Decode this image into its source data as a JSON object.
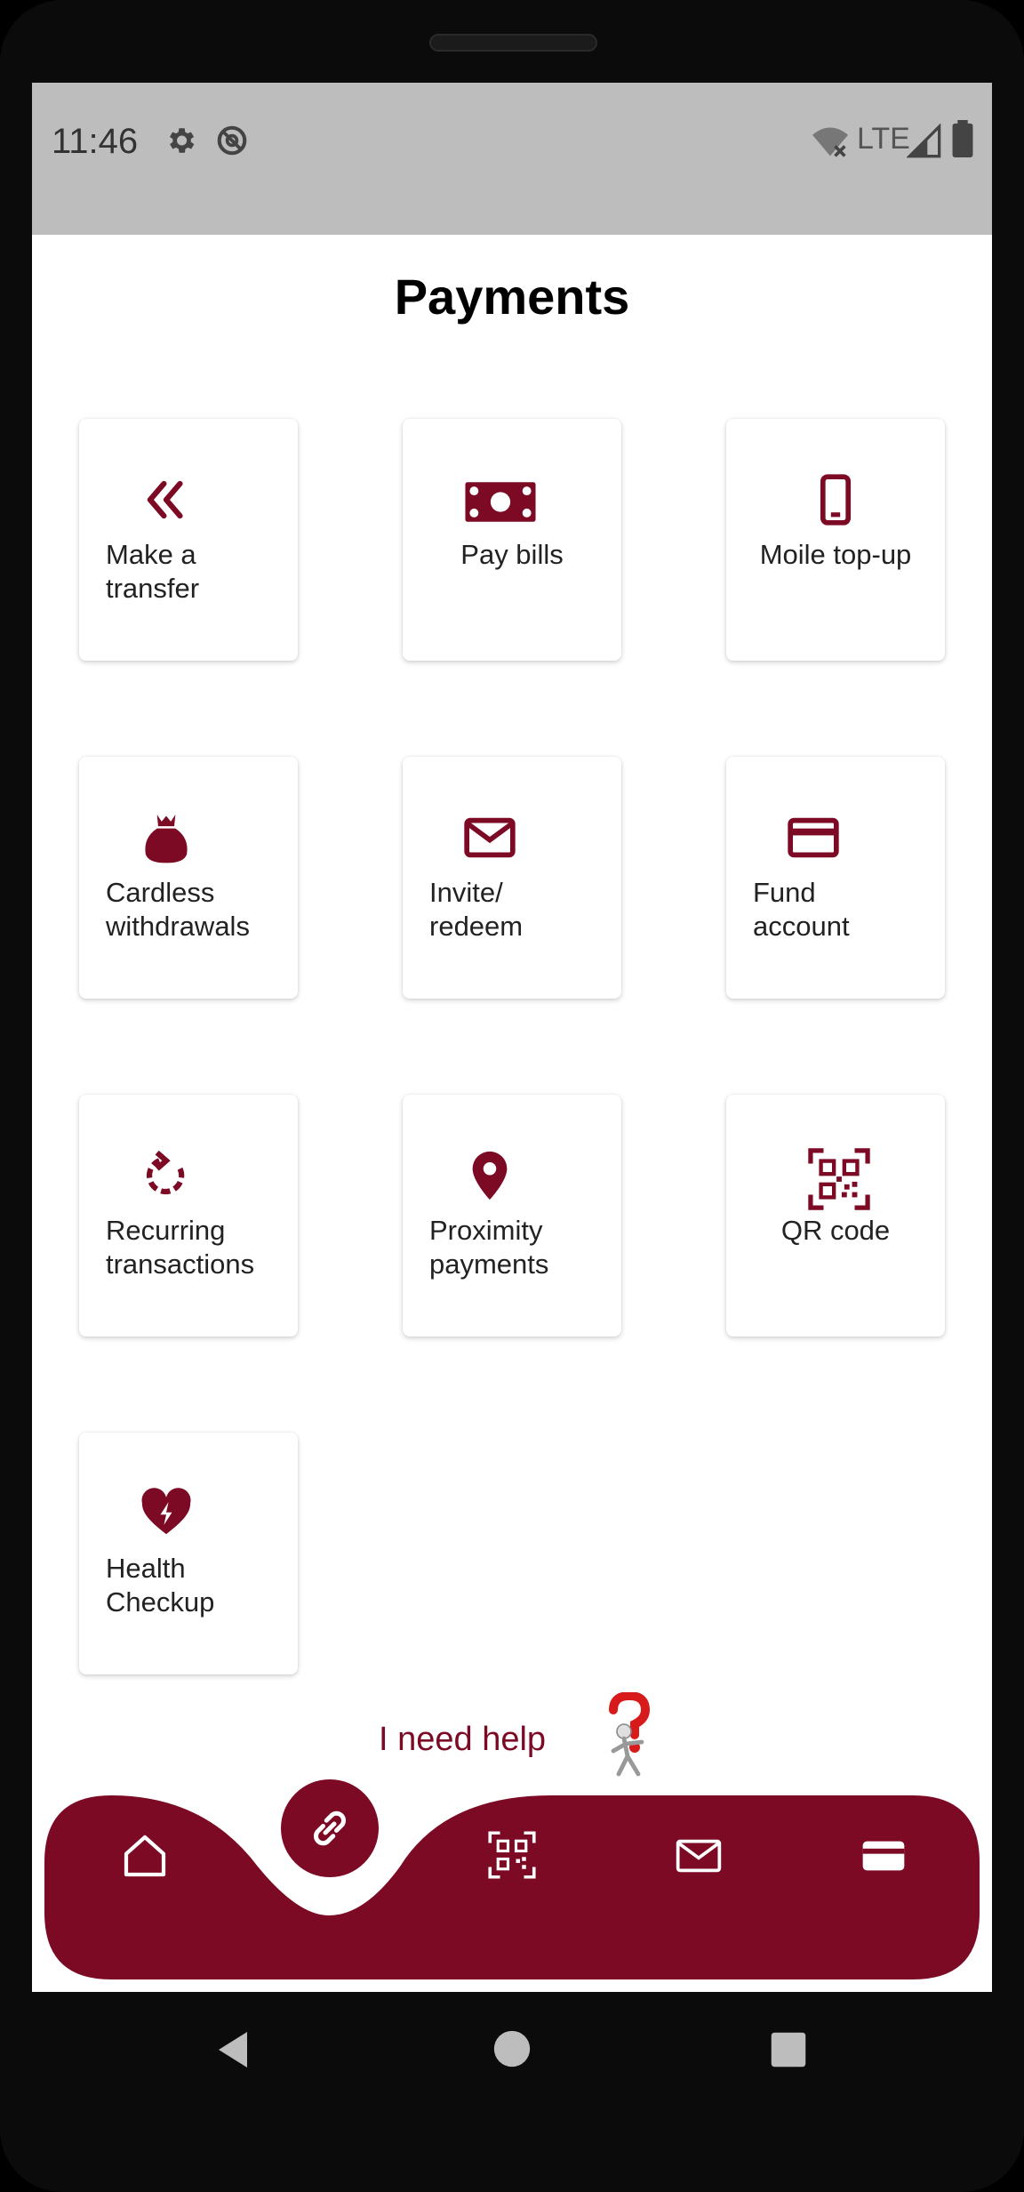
{
  "status_bar": {
    "time": "11:46",
    "network": "LTE",
    "icons": [
      "gear-icon",
      "at-sign-icon",
      "wifi-off-icon",
      "signal-icon",
      "battery-icon"
    ]
  },
  "page": {
    "title": "Payments"
  },
  "colors": {
    "accent": "#7d0a25",
    "status_bar_bg": "#bdbdbd",
    "tile_bg": "#ffffff"
  },
  "tiles": [
    {
      "label": "Make a\ntransfer",
      "icon": "double-chevron-left-icon"
    },
    {
      "label": "Pay bills",
      "icon": "banknote-icon"
    },
    {
      "label": "Moile top-up",
      "icon": "mobile-phone-icon"
    },
    {
      "label": "Cardless\nwithdrawals",
      "icon": "money-bag-icon"
    },
    {
      "label": "Invite/\nredeem",
      "icon": "envelope-icon"
    },
    {
      "label": "Fund\naccount",
      "icon": "credit-card-icon"
    },
    {
      "label": "Recurring\ntransactions",
      "icon": "recurring-arrow-icon"
    },
    {
      "label": "Proximity\npayments",
      "icon": "location-pin-icon"
    },
    {
      "label": "QR code",
      "icon": "qr-code-icon"
    },
    {
      "label": "Health\nCheckup",
      "icon": "heart-bolt-icon"
    }
  ],
  "help": {
    "label": "I need help",
    "icon": "question-mark-figure-icon"
  },
  "bottom_nav": {
    "items": [
      "home-icon",
      "link-icon",
      "qr-code-icon",
      "envelope-icon",
      "wallet-card-icon"
    ],
    "active": "link-icon"
  },
  "system_nav": [
    "back-icon",
    "home-circle-icon",
    "recents-icon"
  ]
}
